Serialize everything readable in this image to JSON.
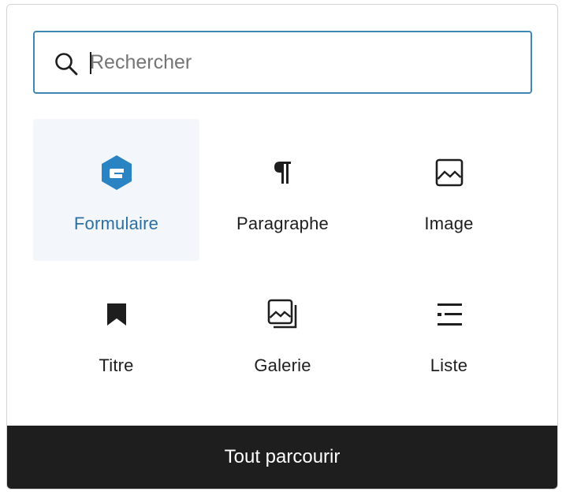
{
  "search": {
    "placeholder": "Rechercher",
    "value": "",
    "icon": "search-icon"
  },
  "blocks": [
    {
      "label": "Formulaire",
      "icon": "gravity-forms-icon",
      "active": true,
      "accent": "#2a70a4"
    },
    {
      "label": "Paragraphe",
      "icon": "paragraph-icon",
      "active": false
    },
    {
      "label": "Image",
      "icon": "image-icon",
      "active": false
    },
    {
      "label": "Titre",
      "icon": "bookmark-icon",
      "active": false
    },
    {
      "label": "Galerie",
      "icon": "gallery-icon",
      "active": false
    },
    {
      "label": "Liste",
      "icon": "list-icon",
      "active": false
    }
  ],
  "footer": {
    "browse_all_label": "Tout parcourir"
  },
  "colors": {
    "accent": "#3e86b8",
    "active_text": "#2a70a4",
    "active_bg": "#f3f7fb",
    "footer_bg": "#1e1e1e"
  }
}
